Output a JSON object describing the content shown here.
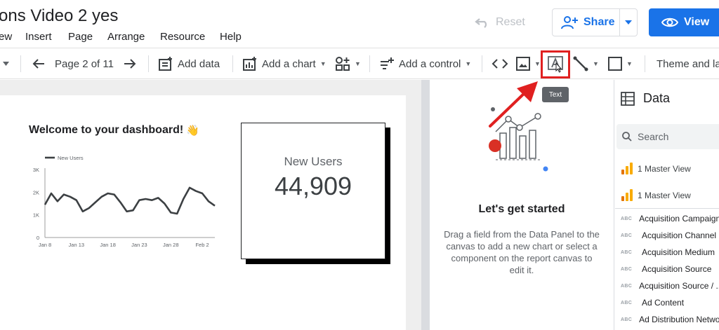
{
  "header": {
    "title": "ons Video 2 yes",
    "reset_label": "Reset",
    "share_label": "Share",
    "view_label": "View"
  },
  "menu": [
    "ew",
    "Insert",
    "Page",
    "Arrange",
    "Resource",
    "Help"
  ],
  "toolbar": {
    "page_indicator": "Page 2 of 11",
    "add_data": "Add data",
    "add_chart": "Add a chart",
    "add_control": "Add a control",
    "theme": "Theme and la",
    "text_tooltip": "Text"
  },
  "report": {
    "welcome_text": "Welcome to your dashboard!",
    "welcome_emoji": "👋",
    "scorecard_label": "New Users",
    "scorecard_value": "44,909"
  },
  "chart_data": {
    "type": "line",
    "title": "",
    "legend": "top-left",
    "series": [
      {
        "name": "New Users",
        "values": [
          1450,
          1950,
          1600,
          1900,
          1800,
          1650,
          1150,
          1300,
          1550,
          1800,
          1950,
          1900,
          1550,
          1150,
          1200,
          1650,
          1700,
          1650,
          1750,
          1500,
          1100,
          1050,
          1700,
          2200,
          2050,
          1950,
          1600,
          1400
        ]
      }
    ],
    "x_ticks": [
      "Jan 8",
      "Jan 13",
      "Jan 18",
      "Jan 23",
      "Jan 28",
      "Feb 2"
    ],
    "y_ticks": [
      "0",
      "1K",
      "2K",
      "3K"
    ],
    "ylim": [
      0,
      3000
    ],
    "grid": false,
    "color": "#3c4043"
  },
  "start_panel": {
    "title": "Let's get started",
    "description": "Drag a field from the Data Panel to the canvas to add a new chart or select a component on the report canvas to edit it."
  },
  "data_panel": {
    "title": "Data",
    "search_placeholder": "Search",
    "sources": [
      "1 Master View",
      "1 Master View"
    ],
    "field_type_label": "ABC",
    "fields": [
      "Acquisition Campaign",
      "Acquisition Channel",
      "Acquisition Medium",
      "Acquisition Source",
      "Acquisition Source / ...",
      "Ad Content",
      "Ad Distribution Network"
    ]
  },
  "colors": {
    "accent": "#1a73e8",
    "highlight": "#e02020",
    "source_icon": "#f9ab00"
  }
}
